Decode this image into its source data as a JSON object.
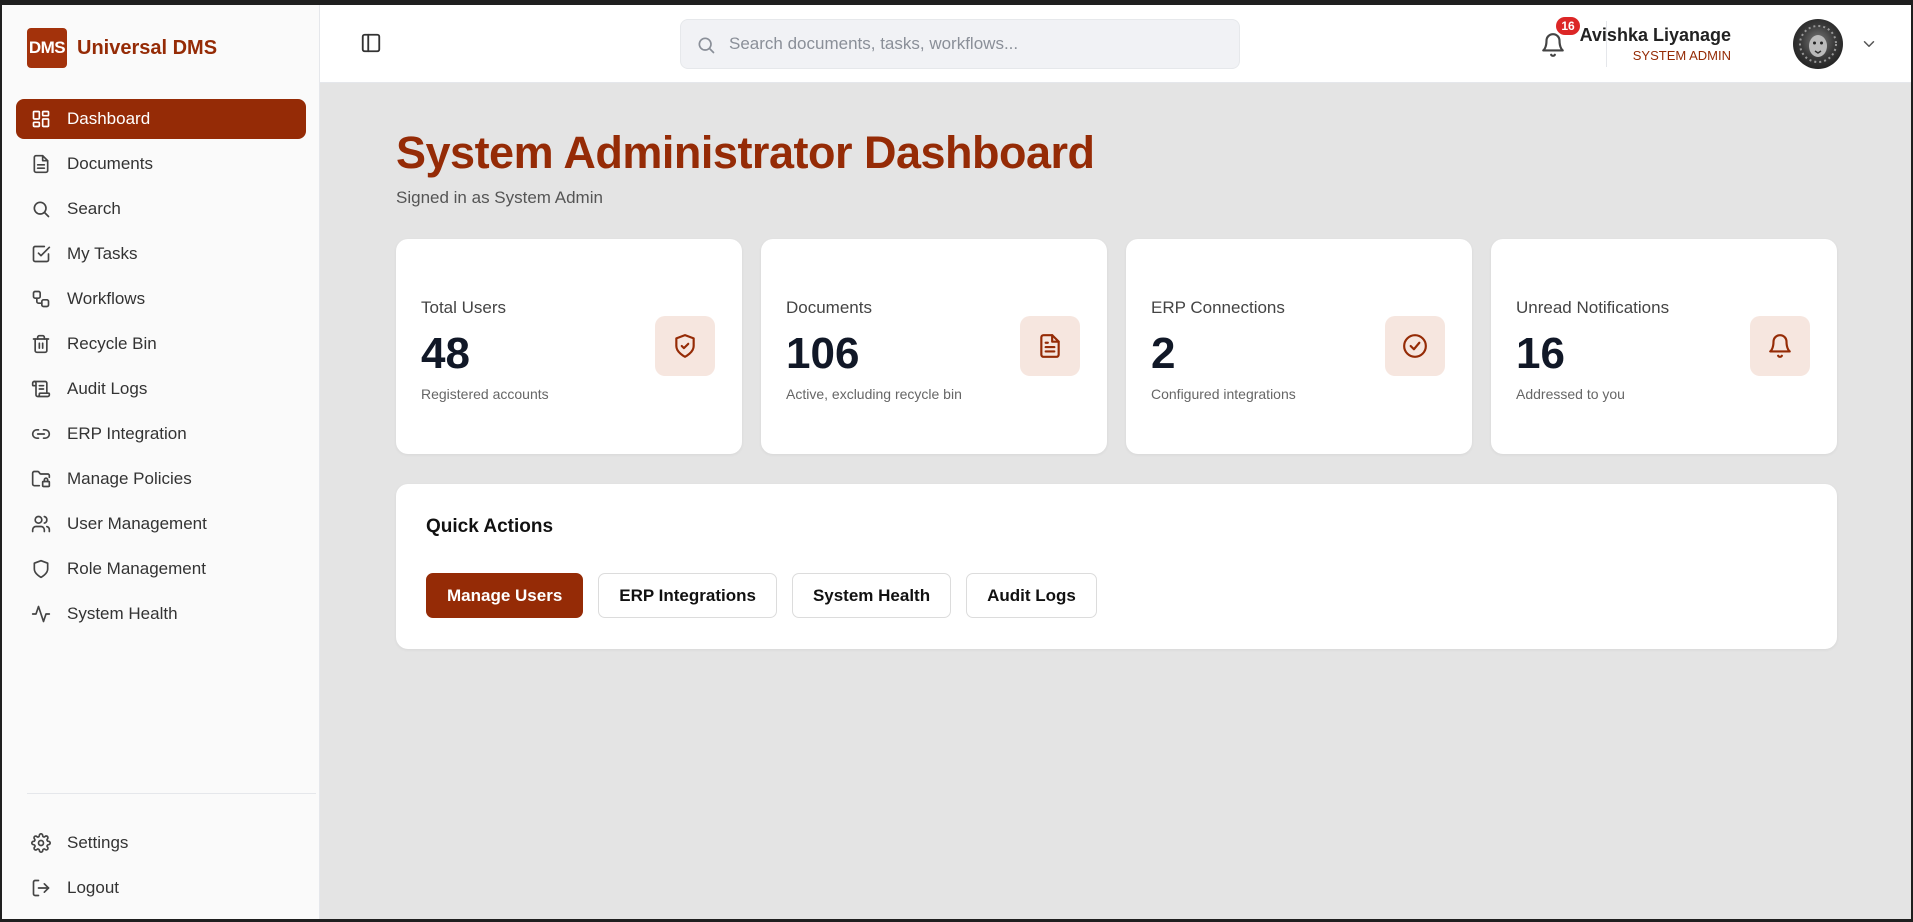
{
  "brand": {
    "logo_text": "DMS",
    "name": "Universal DMS"
  },
  "sidebar": {
    "items": [
      {
        "label": "Dashboard",
        "icon": "dashboard-grid-icon",
        "active": true
      },
      {
        "label": "Documents",
        "icon": "document-icon"
      },
      {
        "label": "Search",
        "icon": "search-icon"
      },
      {
        "label": "My Tasks",
        "icon": "checkbox-icon"
      },
      {
        "label": "Workflows",
        "icon": "workflow-icon"
      },
      {
        "label": "Recycle Bin",
        "icon": "trash-icon"
      },
      {
        "label": "Audit Logs",
        "icon": "scroll-icon"
      },
      {
        "label": "ERP Integration",
        "icon": "link-icon"
      },
      {
        "label": "Manage Policies",
        "icon": "folder-lock-icon"
      },
      {
        "label": "User Management",
        "icon": "users-icon"
      },
      {
        "label": "Role Management",
        "icon": "shield-icon"
      },
      {
        "label": "System Health",
        "icon": "activity-icon"
      }
    ],
    "bottom": [
      {
        "label": "Settings",
        "icon": "gear-icon"
      },
      {
        "label": "Logout",
        "icon": "logout-icon"
      }
    ]
  },
  "header": {
    "search_placeholder": "Search documents, tasks, workflows...",
    "notification_count": "16",
    "user_name": "Avishka Liyanage",
    "user_role": "SYSTEM ADMIN"
  },
  "main": {
    "title": "System Administrator Dashboard",
    "subtitle": "Signed in as System Admin",
    "stats": [
      {
        "label": "Total Users",
        "value": "48",
        "desc": "Registered accounts",
        "icon": "shield-check-icon"
      },
      {
        "label": "Documents",
        "value": "106",
        "desc": "Active, excluding recycle bin",
        "icon": "document-icon"
      },
      {
        "label": "ERP Connections",
        "value": "2",
        "desc": "Configured integrations",
        "icon": "check-circle-icon"
      },
      {
        "label": "Unread Notifications",
        "value": "16",
        "desc": "Addressed to you",
        "icon": "bell-icon"
      }
    ],
    "quick_actions": {
      "title": "Quick Actions",
      "buttons": [
        "Manage Users",
        "ERP Integrations",
        "System Health",
        "Audit Logs"
      ]
    }
  },
  "colors": {
    "accent": "#952b06",
    "badge": "#dc2626",
    "icon_bg": "#f6e6df"
  }
}
